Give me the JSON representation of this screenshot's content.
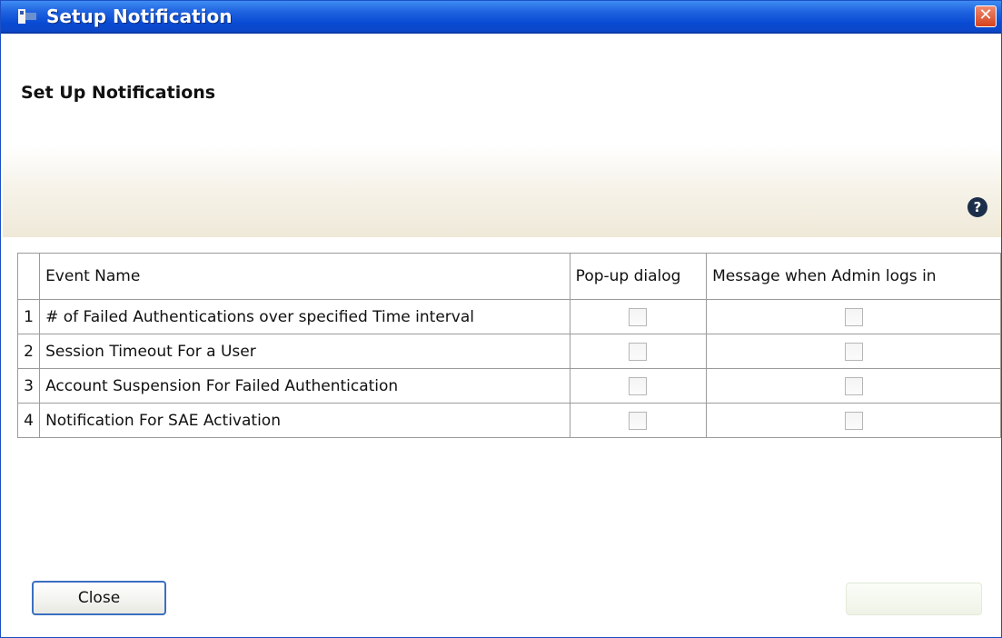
{
  "window": {
    "title": "Setup Notification"
  },
  "section": {
    "title": "Set Up Notifications"
  },
  "table": {
    "columns": [
      "Event Name",
      "Pop-up dialog",
      "Message when Admin logs in"
    ],
    "rows": [
      {
        "num": "1",
        "event": "# of Failed Authentications over specified Time interval",
        "popup": false,
        "message": false
      },
      {
        "num": "2",
        "event": "Session Timeout For a User",
        "popup": false,
        "message": false
      },
      {
        "num": "3",
        "event": "Account Suspension For Failed Authentication",
        "popup": false,
        "message": false
      },
      {
        "num": "4",
        "event": "Notification For SAE Activation",
        "popup": false,
        "message": false
      }
    ]
  },
  "footer": {
    "close_label": "Close"
  },
  "colors": {
    "titlebar": "#1f63e0",
    "close_button": "#d5431e"
  }
}
